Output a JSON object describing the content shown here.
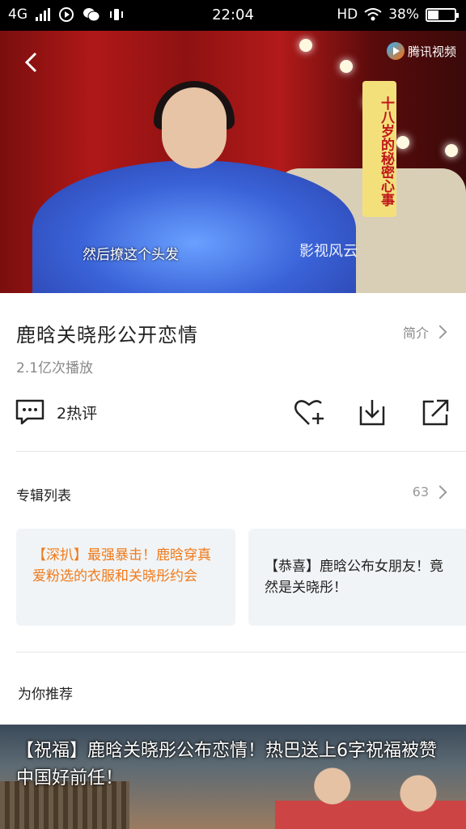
{
  "status_bar": {
    "network": "4G",
    "time": "22:04",
    "hd": "HD",
    "battery": "38%",
    "battery_level": 0.38
  },
  "video": {
    "subtitle": "然后撩这个头发",
    "logo_text": "腾讯视频",
    "tag_text": "十八岁的秘密心事",
    "watermark": "影视风云"
  },
  "info": {
    "title": "鹿晗关晓彤公开恋情",
    "intro_label": "简介",
    "plays": "2.1亿次播放"
  },
  "actions": {
    "comment_label": "2热评"
  },
  "album": {
    "heading": "专辑列表",
    "count": "63",
    "items": [
      {
        "label": "【深扒】最强暴击！鹿晗穿真爱粉选的衣服和关晓彤约会"
      },
      {
        "label": "【恭喜】鹿晗公布女朋友！竟然是关晓彤！"
      }
    ]
  },
  "recommend": {
    "heading": "为你推荐",
    "caption": "【祝福】鹿晗关晓彤公布恋情！热巴送上6字祝福被赞中国好前任！"
  },
  "colors": {
    "accent_orange": "#f07a1a",
    "card_bg": "#f1f4f6"
  }
}
